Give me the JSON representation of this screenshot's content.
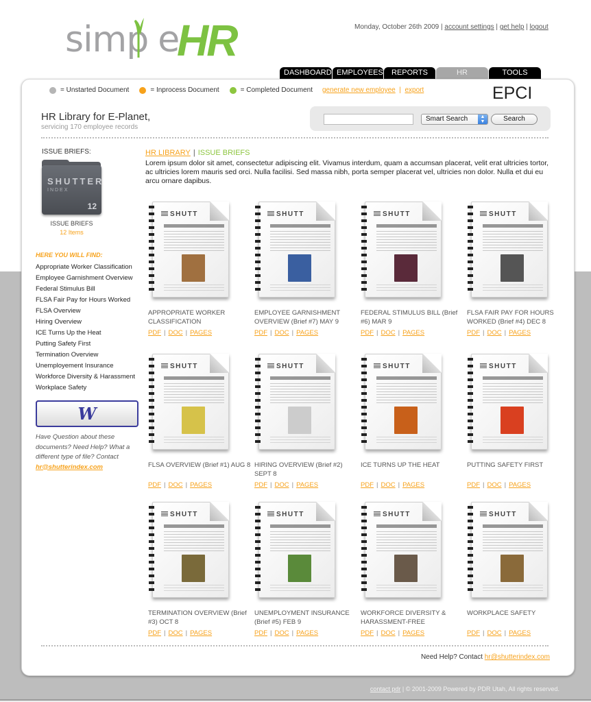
{
  "logo": {
    "part1": "simp",
    "part2": "e",
    "part3": "HR"
  },
  "top": {
    "date": "Monday, October 26th 2009",
    "links": [
      "account settings",
      "get help",
      "logout"
    ]
  },
  "tabs": [
    {
      "label": "DASHBOARD",
      "active": false
    },
    {
      "label": "EMPLOYEES",
      "active": false
    },
    {
      "label": "REPORTS",
      "active": false
    },
    {
      "label": "HR LIBRARY",
      "active": true
    },
    {
      "label": "TOOLS",
      "active": false
    }
  ],
  "legend": {
    "items": [
      {
        "label": "= Unstarted Document",
        "color": "#b5b5b5"
      },
      {
        "label": "= Inprocess Document",
        "color": "#f7a21b"
      },
      {
        "label": "= Completed Document",
        "color": "#8dc63f"
      }
    ],
    "actions": [
      "generate new employee",
      "export"
    ]
  },
  "company_code": "EPCI",
  "library": {
    "title": "HR Library for E-Planet,",
    "subtitle": "servicing 170 employee records"
  },
  "search": {
    "value": "",
    "placeholder": "",
    "mode": "Smart Search",
    "button": "Search"
  },
  "sidebar": {
    "heading": "ISSUE BRIEFS:",
    "folder_brand": "SHUTTER",
    "folder_sub": "INDEX",
    "folder_count": "12",
    "caption": "ISSUE BRIEFS",
    "items_count": "12 Items",
    "find_heading": "HERE YOU WILL FIND:",
    "find_list": [
      "Appropriate Worker Classification",
      "Employee Garnishment Overview",
      "Federal Stimulus Bill",
      "FLSA Fair Pay for Hours Worked",
      "FLSA Overview",
      "Hiring Overview",
      "ICE Turns Up the Heat",
      "Putting Safety First",
      "Termination Overview",
      "Unemployement Insurance",
      "Workforce Diversity & Harassment",
      "Workplace Safety"
    ],
    "file_types": [
      "pdf-icon",
      "word-icon",
      "pages-icon"
    ],
    "help_text": "Have Question about these documents? Need Help? What a different type of file? Contact",
    "help_email": "hr@shutterindex.com"
  },
  "breadcrumb": {
    "first": "HR LIBRARY",
    "sep": "|",
    "second": "ISSUE BRIEFS"
  },
  "intro": "Lorem ipsum dolor sit amet, consectetur adipiscing elit. Vivamus interdum, quam a accumsan placerat, velit erat ultricies tortor, ac ultricies lorem mauris sed orci. Nulla facilisi. Sed massa nibh, porta semper placerat vel, ultricies non dolor. Nulla et dui eu arcu ornare dapibus.",
  "thumb_brand": "SHUTT",
  "doc_links": [
    "PDF",
    "DOC",
    "PAGES"
  ],
  "documents": [
    {
      "title": "APPROPRIATE WORKER CLASSIFICATION",
      "pic": "#a07040"
    },
    {
      "title": "EMPLOYEE GARNISHMENT OVERVIEW (Brief #7) MAY 9",
      "pic": "#3a5fa0"
    },
    {
      "title": "FEDERAL STIMULUS BILL (Brief #6) MAR 9",
      "pic": "#5a2a3a"
    },
    {
      "title": "FLSA FAIR PAY FOR HOURS WORKED (Brief #4) DEC 8",
      "pic": "#555555"
    },
    {
      "title": "FLSA OVERVIEW (Brief #1) AUG 8",
      "pic": "#d6c24a"
    },
    {
      "title": "HIRING OVERVIEW (Brief #2) SEPT 8",
      "pic": "#cccccc"
    },
    {
      "title": "ICE TURNS UP THE HEAT",
      "pic": "#c8601a"
    },
    {
      "title": "PUTTING SAFETY FIRST",
      "pic": "#d94020"
    },
    {
      "title": "TERMINATION OVERVIEW (Brief #3) OCT 8",
      "pic": "#7a6a3a"
    },
    {
      "title": "UNEMPLOYMENT INSURANCE (Brief #5) FEB 9",
      "pic": "#5a8a3a"
    },
    {
      "title": "WORKFORCE DIVERSITY & HARASSMENT-FREE",
      "pic": "#6a5a4a"
    },
    {
      "title": "WORKPLACE SAFETY",
      "pic": "#8a6a3a"
    }
  ],
  "footer_help": {
    "text": "Need Help? Contact",
    "email": "hr@shutterindex.com"
  },
  "footer": {
    "link": "contact pdr",
    "text": " | © 2001-2009 Powered by PDR Utah, All rights reserved."
  }
}
